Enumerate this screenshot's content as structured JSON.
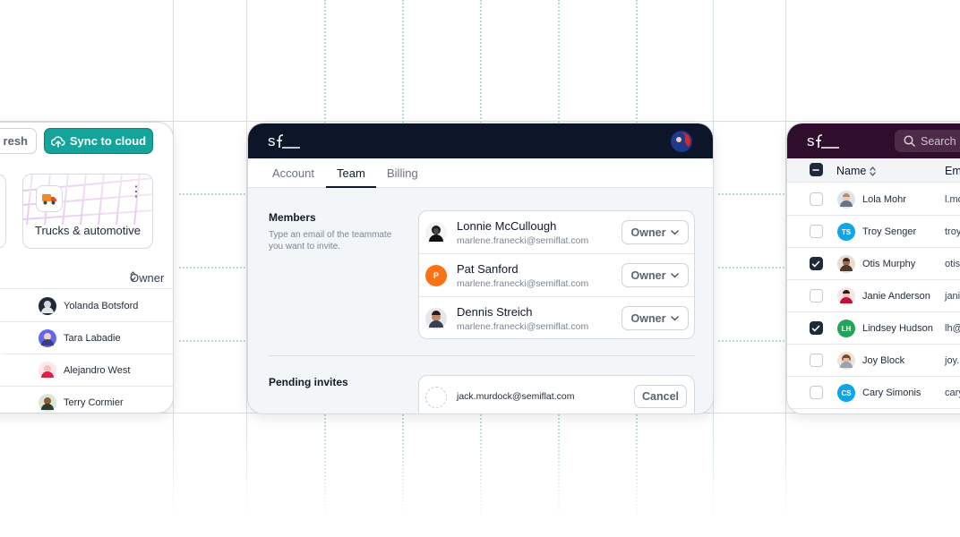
{
  "colors": {
    "teal": "#15a39a",
    "navy": "#0d1628",
    "plum": "#2f0d2c",
    "grid": "#cfe3e6"
  },
  "left_card": {
    "refresh_label": "resh",
    "sync_label": "Sync to cloud",
    "sync_icon": "cloud-upload-icon",
    "tile": {
      "label": "Trucks & automotive",
      "icon": "truck-icon"
    },
    "owner_header": "Owner",
    "rows": [
      {
        "name": "Yolanda Botsford"
      },
      {
        "name": "Tara Labadie"
      },
      {
        "name": "Alejandro West"
      },
      {
        "name": "Terry Cormier"
      }
    ]
  },
  "middle_card": {
    "tabs": [
      "Account",
      "Team",
      "Billing"
    ],
    "active_tab": "Team",
    "members_title": "Members",
    "members_desc": "Type an email of the teammate you want to invite.",
    "members": [
      {
        "name": "Lonnie McCullough",
        "email": "marlene.franecki@semiflat.com",
        "role": "Owner"
      },
      {
        "name": "Pat Sanford",
        "email": "marlene.franecki@semiflat.com",
        "role": "Owner",
        "initial": "P"
      },
      {
        "name": "Dennis Streich",
        "email": "marlene.franecki@semiflat.com",
        "role": "Owner"
      }
    ],
    "pending_title": "Pending invites",
    "pending": [
      {
        "email": "jack.murdock@semiflat.com",
        "action": "Cancel"
      }
    ]
  },
  "right_card": {
    "search_label": "Search",
    "col_name": "Name",
    "col_email": "Em",
    "rows": [
      {
        "name": "Lola Mohr",
        "email": "l.mo",
        "checked": false
      },
      {
        "name": "Troy Senger",
        "email": "troy",
        "checked": false,
        "initials": "TS"
      },
      {
        "name": "Otis Murphy",
        "email": "otis",
        "checked": true
      },
      {
        "name": "Janie Anderson",
        "email": "jani",
        "checked": false
      },
      {
        "name": "Lindsey Hudson",
        "email": "lh@",
        "checked": true,
        "initials": "LH"
      },
      {
        "name": "Joy Block",
        "email": "joy.",
        "checked": false
      },
      {
        "name": "Cary Simonis",
        "email": "cary",
        "checked": false,
        "initials": "CS"
      }
    ]
  }
}
